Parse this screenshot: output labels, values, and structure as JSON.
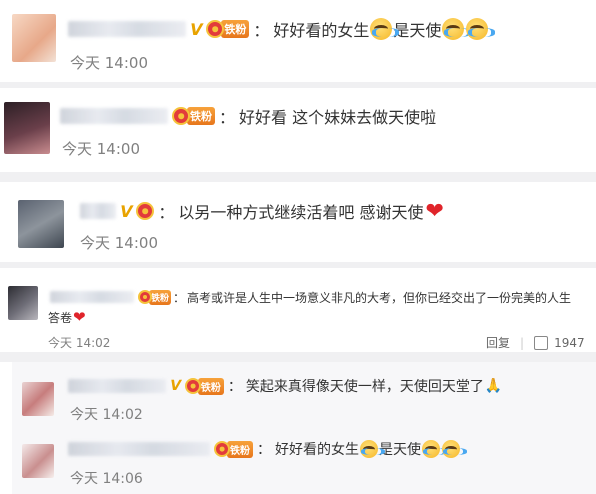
{
  "badge_label": "铁粉",
  "colon": "：",
  "comments": [
    {
      "text_a": "好好看的女生",
      "text_b": "是天使",
      "time": "今天 14:00"
    },
    {
      "text_a": "好好看 这个妹妹去做天使啦",
      "time": "今天 14:00"
    },
    {
      "text_a": "以另一种方式继续活着吧 感谢天使",
      "time": "今天 14:00"
    },
    {
      "text_a": "高考或许是人生中一场意义非凡的大考，但你已经交出了一份完美的人生",
      "text_b": "答卷",
      "time": "今天 14:02",
      "reply_label": "回复",
      "like_count": "1947"
    },
    {
      "text_a": "笑起来真得像天使一样，天使回天堂了",
      "time": "今天 14:02"
    },
    {
      "text_a": "好好看的女生",
      "text_b": "是天使",
      "time": "今天 14:06"
    }
  ],
  "icons": {
    "cry": "crying-face-emoji",
    "heart": "red-heart-emoji",
    "pray": "folded-hands-emoji",
    "thumb": "thumbs-up-icon"
  },
  "colors": {
    "background": "#f0f0f2",
    "badge": "#e7761c",
    "text": "#333333",
    "time": "#808080"
  }
}
